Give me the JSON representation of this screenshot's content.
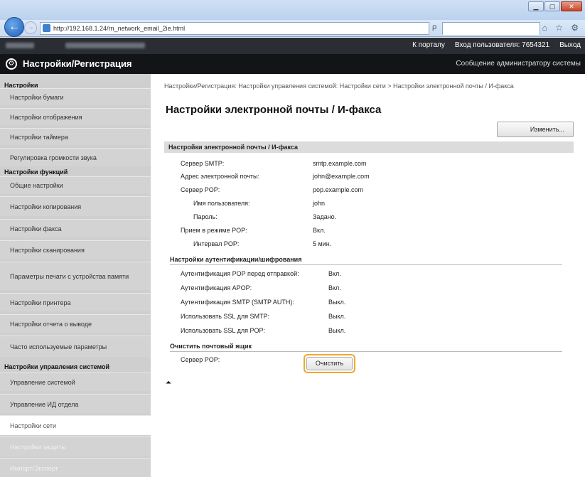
{
  "browser": {
    "url": "http://192.168.1.24/rn_network_email_2ie.html",
    "addr_tools": "ρ ▾ ≣ ♂ ✕",
    "tab_title": "",
    "tab_tools": "⌂ ☆ ⚙"
  },
  "header": {
    "portal_link": "К порталу",
    "login_user": "Вход пользователя:  7654321",
    "logout": "Выход",
    "app_title": "Настройки/Регистрация",
    "admin_message": "Сообщение администратору системы"
  },
  "sidebar": {
    "sections": [
      {
        "title": "Настройки",
        "items": [
          "Настройки бумаги",
          "Настройки отображения",
          "Настройки таймера",
          "Регулировка громкости звука"
        ]
      },
      {
        "title": "Настройки функций",
        "items": [
          "Общие настройки",
          "Настройки копирования",
          "Настройки факса",
          "Настройки сканирования",
          "Параметры печати с устройства памяти",
          "Настройки принтера",
          "Настройки отчета о выводе",
          "Часто используемые параметры"
        ]
      },
      {
        "title": "Настройки управления системой",
        "items": [
          "Управление системой",
          "Управление ИД отдела",
          "Настройки сети",
          "Настройки защиты",
          "Импорт/Экспорт"
        ]
      }
    ]
  },
  "main": {
    "breadcrumb": "Настройки/Регистрация: Настройки управления системой: Настройки сети > Настройки электронной почты / И-факса",
    "title": "Настройки электронной почты / И-факса",
    "edit_button": "Изменить...",
    "section_title": "Настройки электронной почты / И-факса",
    "rows": [
      {
        "label": "Сервер SMTP:",
        "value": "smtp.example.com"
      },
      {
        "label": "Адрес электронной почты:",
        "value": "john@example.com"
      },
      {
        "label": "Сервер POP:",
        "value": "pop.example.com"
      },
      {
        "label": "Имя пользователя:",
        "value": "john"
      },
      {
        "label": "Пароль:",
        "value": "Задано."
      },
      {
        "label": "Прием в режиме POP:",
        "value": "Вкл."
      },
      {
        "label": "Интервал POP:",
        "value": "5 мин."
      }
    ],
    "auth_section_title": "Настройки аутентификации/шифрования",
    "auth_rows": [
      {
        "label": "Аутентификация POP перед отправкой:",
        "value": "Вкл."
      },
      {
        "label": "Аутентификация APOP:",
        "value": "Вкл."
      },
      {
        "label": "Аутентификация SMTP (SMTP AUTH):",
        "value": "Выкл."
      },
      {
        "label": "Использовать SSL для SMTP:",
        "value": "Выкл."
      },
      {
        "label": "Использовать SSL для POP:",
        "value": "Выкл."
      }
    ],
    "clear_section_title": "Очистить почтовый ящик",
    "clear_label": "Сервер POP:",
    "clear_button": "Очистить",
    "top_icon_glyph": "⏶"
  },
  "colors": {
    "header_dark": "#121418",
    "sidebar_bg": "#cfcfcf",
    "highlight": "#f0a92b"
  }
}
